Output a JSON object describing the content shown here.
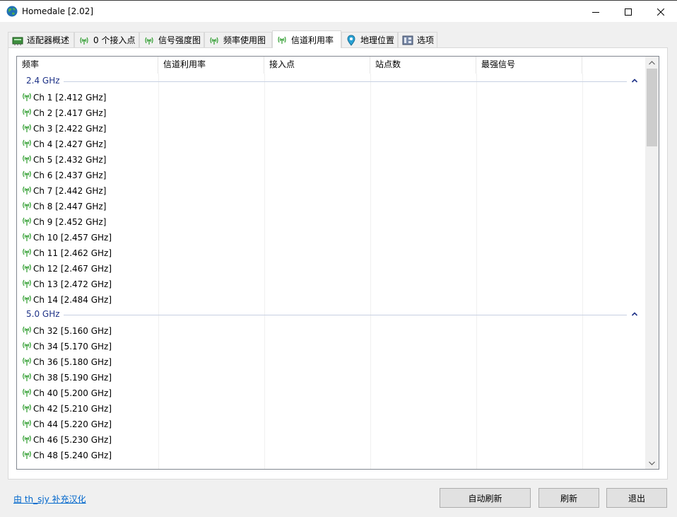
{
  "window": {
    "title": "Homedale [2.02]"
  },
  "tabs": [
    {
      "label": "适配器概述",
      "icon": "network-adapter-icon"
    },
    {
      "label": "0 个接入点",
      "icon": "wifi-signal-icon"
    },
    {
      "label": "信号强度图",
      "icon": "wifi-signal-icon"
    },
    {
      "label": "频率使用图",
      "icon": "wifi-signal-icon"
    },
    {
      "label": "信道利用率",
      "icon": "wifi-signal-icon",
      "active": true
    },
    {
      "label": "地理位置",
      "icon": "map-pin-icon"
    },
    {
      "label": "选项",
      "icon": "options-icon"
    }
  ],
  "table": {
    "columns": [
      "频率",
      "信道利用率",
      "接入点",
      "站点数",
      "最强信号"
    ],
    "groups": [
      {
        "label": "2.4 GHz",
        "rows": [
          "Ch 1 [2.412 GHz]",
          "Ch 2 [2.417 GHz]",
          "Ch 3 [2.422 GHz]",
          "Ch 4 [2.427 GHz]",
          "Ch 5 [2.432 GHz]",
          "Ch 6 [2.437 GHz]",
          "Ch 7 [2.442 GHz]",
          "Ch 8 [2.447 GHz]",
          "Ch 9 [2.452 GHz]",
          "Ch 10 [2.457 GHz]",
          "Ch 11 [2.462 GHz]",
          "Ch 12 [2.467 GHz]",
          "Ch 13 [2.472 GHz]",
          "Ch 14 [2.484 GHz]"
        ]
      },
      {
        "label": "5.0 GHz",
        "rows": [
          "Ch 32 [5.160 GHz]",
          "Ch 34 [5.170 GHz]",
          "Ch 36 [5.180 GHz]",
          "Ch 38 [5.190 GHz]",
          "Ch 40 [5.200 GHz]",
          "Ch 42 [5.210 GHz]",
          "Ch 44 [5.220 GHz]",
          "Ch 46 [5.230 GHz]",
          "Ch 48 [5.240 GHz]"
        ]
      }
    ]
  },
  "footer": {
    "credit": "由 th_sjy 补充汉化",
    "auto_refresh": "自动刷新",
    "refresh": "刷新",
    "exit": "退出"
  },
  "colors": {
    "signal_green": "#2e9d2e",
    "group_blue": "#1e3287",
    "link": "#0066cc"
  }
}
